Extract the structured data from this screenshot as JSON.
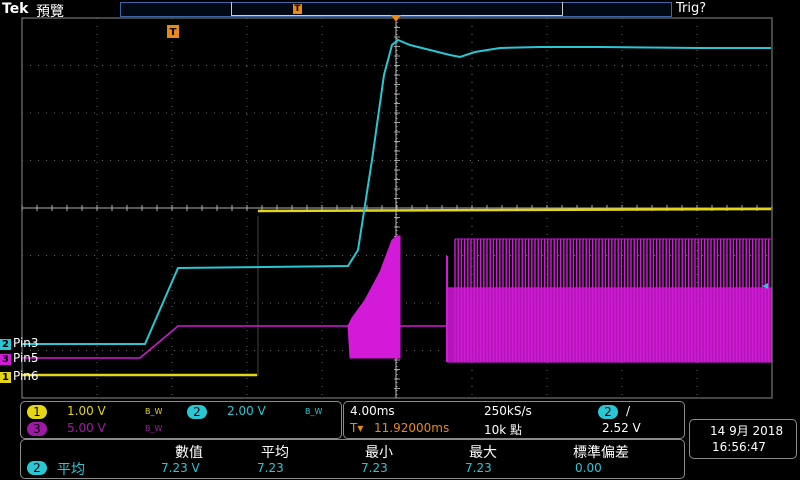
{
  "header": {
    "brand": "Tek",
    "mode": "預覽",
    "trigger_status": "Trig?",
    "trigger_marker": "T"
  },
  "channels": [
    {
      "num": "2",
      "name": "Pin3",
      "color": "#29c7d4"
    },
    {
      "num": "3",
      "name": "Pin5",
      "color": "#d21ad8"
    },
    {
      "num": "1",
      "name": "Pin6",
      "color": "#e4d613"
    }
  ],
  "vertical": {
    "ch1": {
      "num": "1",
      "scale": "1.00 V",
      "bw": "B_W",
      "color": "#e4d613"
    },
    "ch2": {
      "num": "2",
      "scale": "2.00 V",
      "bw": "B_W",
      "color": "#29c7d4"
    },
    "ch3": {
      "num": "3",
      "scale": "5.00 V",
      "bw": "B_W",
      "color": "#d21ad8"
    }
  },
  "horizontal": {
    "timebase": "4.00ms",
    "sample_rate": "250kS/s",
    "trigger_pos": "11.92000ms",
    "record_length": "10k 點",
    "trig_channel": "2",
    "trig_slope": "/",
    "trig_level": "2.52 V"
  },
  "datetime": {
    "date": "14 9月 2018",
    "time": "16:56:47"
  },
  "measurements": {
    "headers": [
      "數值",
      "平均",
      "最小",
      "最大",
      "標準偏差"
    ],
    "row": {
      "channel": "2",
      "name": "平均",
      "values": [
        "7.23 V",
        "7.23",
        "7.23",
        "7.23",
        "0.00"
      ]
    }
  },
  "colors": {
    "ch1": "#e4d613",
    "ch2": "#29c7d4",
    "ch3": "#d21ad8",
    "grid": "#7a7a7a",
    "trigger": "#e98a16"
  }
}
